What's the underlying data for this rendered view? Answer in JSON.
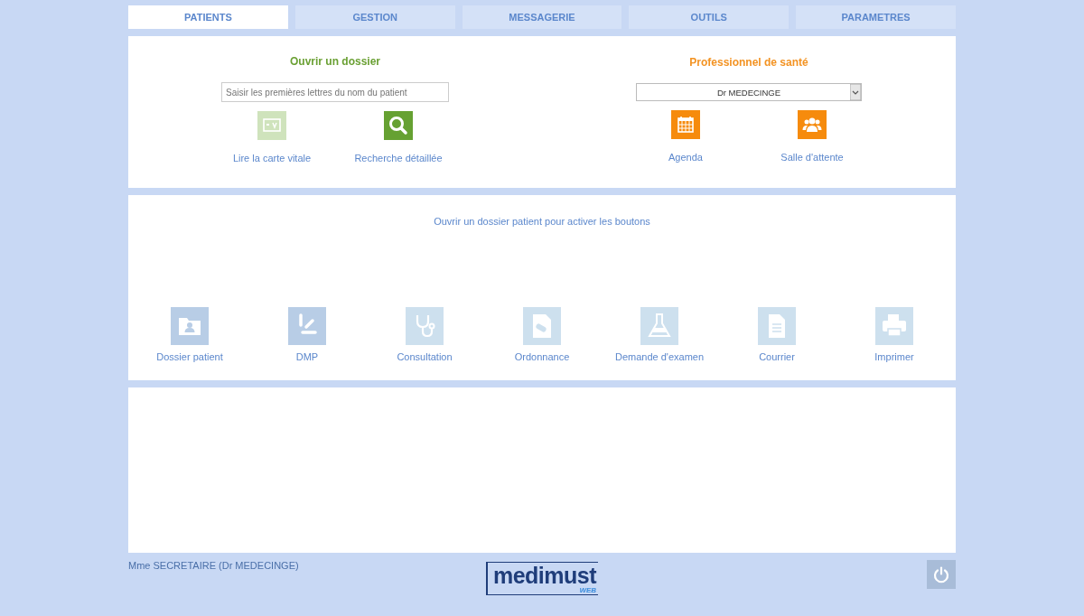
{
  "tabs": [
    {
      "label": "PATIENTS",
      "selected": true
    },
    {
      "label": "GESTION",
      "selected": false
    },
    {
      "label": "MESSAGERIE",
      "selected": false
    },
    {
      "label": "OUTILS",
      "selected": false
    },
    {
      "label": "PARAMETRES",
      "selected": false
    }
  ],
  "open_file": {
    "title": "Ouvrir un dossier",
    "search": {
      "placeholder": "Saisir les premières lettres du nom du patient"
    },
    "actions": [
      {
        "kind": "card",
        "label": "Lire la carte vitale",
        "disabled": true
      },
      {
        "kind": "search",
        "label": "Recherche détaillée",
        "disabled": false
      }
    ]
  },
  "practitioner": {
    "title": "Professionnel de santé",
    "select": {
      "value": "Dr MEDECINGE"
    },
    "actions": [
      {
        "kind": "calendar",
        "label": "Agenda"
      },
      {
        "kind": "group",
        "label": "Salle d'attente"
      }
    ]
  },
  "patient_actions": {
    "message": "Ouvrir un dossier patient pour activer les boutons",
    "buttons": [
      {
        "kind": "folder",
        "label": "Dossier patient",
        "highlighted": true
      },
      {
        "kind": "dmp",
        "label": "DMP",
        "highlighted": true
      },
      {
        "kind": "stethoscope",
        "label": "Consultation",
        "highlighted": false
      },
      {
        "kind": "prescription",
        "label": "Ordonnance",
        "highlighted": false
      },
      {
        "kind": "flask",
        "label": "Demande d'examen",
        "highlighted": false
      },
      {
        "kind": "document",
        "label": "Courrier",
        "highlighted": false
      },
      {
        "kind": "printer",
        "label": "Imprimer",
        "highlighted": false
      }
    ]
  },
  "footer": {
    "user": "Mme SECRETAIRE (Dr MEDECINGE)",
    "logo": {
      "name": "medimust",
      "sub": "WEB"
    }
  }
}
